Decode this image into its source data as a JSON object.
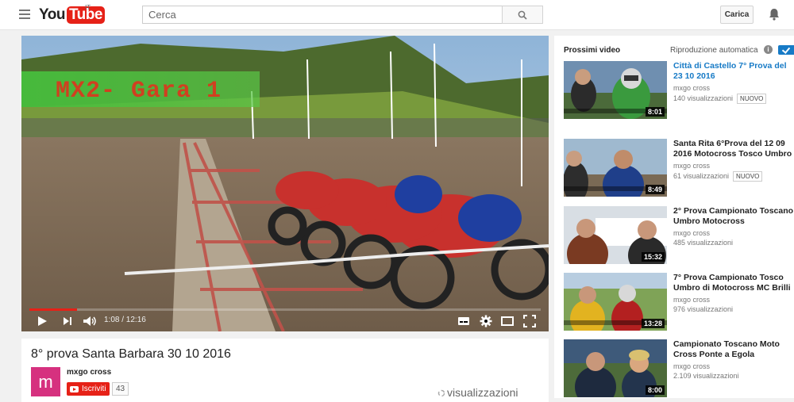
{
  "masthead": {
    "logo_you": "You",
    "logo_tube": "Tube",
    "logo_country": "IT",
    "search_placeholder": "Cerca",
    "upload_label": "Carica"
  },
  "player": {
    "overlay_title": "MX2- Gara 1",
    "time_current": "1:08",
    "time_total": "12:16",
    "time_display": "1:08 / 12:16",
    "progress_fraction": 0.0924
  },
  "video": {
    "title": "8° prova Santa Barbara 30 10 2016",
    "channel": "mxgo cross",
    "avatar_letter": "m",
    "subscribe_label": "Iscriviti",
    "subscriber_count": "43",
    "views_label": "visualizzazioni"
  },
  "sidebar": {
    "heading": "Prossimi video",
    "autoplay_label": "Riproduzione automatica",
    "autoplay_on": true,
    "items": [
      {
        "title": "Città di Castello 7° Prova del 23 10 2016",
        "channel": "mxgo cross",
        "views": "140 visualizzazioni",
        "badge": "NUOVO",
        "duration": "8:01"
      },
      {
        "title": "Santa Rita 6°Prova del 12 09 2016 Motocross Tosco Umbro",
        "channel": "mxgo cross",
        "views": "61 visualizzazioni",
        "badge": "NUOVO",
        "duration": "8:49"
      },
      {
        "title": "2° Prova Campionato Toscano Umbro Motocross",
        "channel": "mxgo cross",
        "views": "485 visualizzazioni",
        "badge": "",
        "duration": "15:32"
      },
      {
        "title": "7° Prova Campionato Tosco Umbro di Motocross MC Brilli",
        "channel": "mxgo cross",
        "views": "976 visualizzazioni",
        "badge": "",
        "duration": "13:28"
      },
      {
        "title": "Campionato Toscano Moto Cross Ponte a Egola",
        "channel": "mxgo cross",
        "views": "2.109 visualizzazioni",
        "badge": "",
        "duration": "8:00"
      }
    ]
  },
  "colors": {
    "brand_red": "#e62117",
    "link_blue": "#167ac6",
    "avatar_pink": "#d6317f"
  }
}
